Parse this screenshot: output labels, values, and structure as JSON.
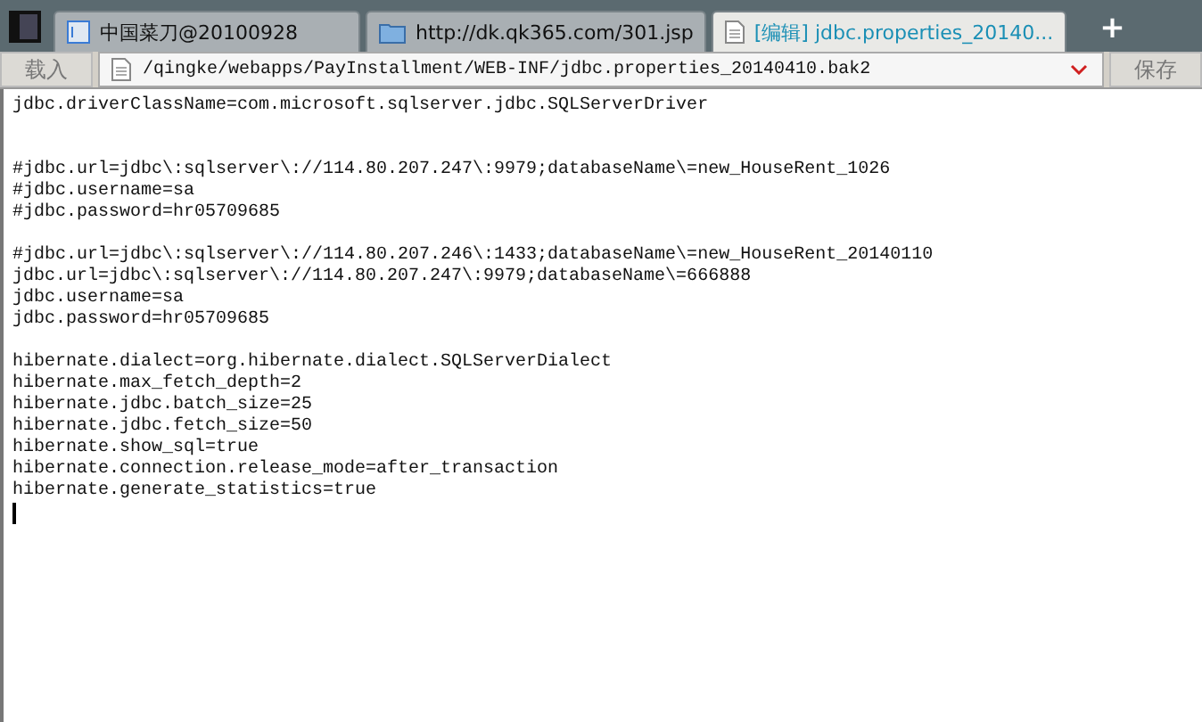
{
  "tabs": [
    {
      "kind": "shell",
      "label": "中国菜刀@20100928",
      "selected": false
    },
    {
      "kind": "folder",
      "label": "http://dk.qk365.com/301.jsp",
      "selected": false
    },
    {
      "kind": "file",
      "label": "[编辑] jdbc.properties_20140...",
      "selected": true
    }
  ],
  "new_tab": "+",
  "toolbar": {
    "load_button": "载入",
    "path": "/qingke/webapps/PayInstallment/WEB-INF/jdbc.properties_20140410.bak2",
    "save_button": "保存"
  },
  "editor": {
    "blocks": [
      {
        "lines": [
          "jdbc.driverClassName=com.microsoft.sqlserver.jdbc.SQLServerDriver"
        ]
      },
      {
        "lines": [
          "#jdbc.url=jdbc\\:sqlserver\\://114.80.207.247\\:9979;databaseName\\=new_HouseRent_1026",
          "#jdbc.username=sa",
          "#jdbc.password=hr05709685"
        ]
      },
      {
        "lines": [
          "#jdbc.url=jdbc\\:sqlserver\\://114.80.207.246\\:1433;databaseName\\=new_HouseRent_20140110",
          "jdbc.url=jdbc\\:sqlserver\\://114.80.207.247\\:9979;databaseName\\=666888",
          "jdbc.username=sa",
          "jdbc.password=hr05709685"
        ]
      },
      {
        "lines": [
          "hibernate.dialect=org.hibernate.dialect.SQLServerDialect",
          "hibernate.max_fetch_depth=2",
          "hibernate.jdbc.batch_size=25",
          "hibernate.jdbc.fetch_size=50",
          "hibernate.show_sql=true",
          "hibernate.connection.release_mode=after_transaction",
          "hibernate.generate_statistics=true"
        ]
      }
    ]
  }
}
